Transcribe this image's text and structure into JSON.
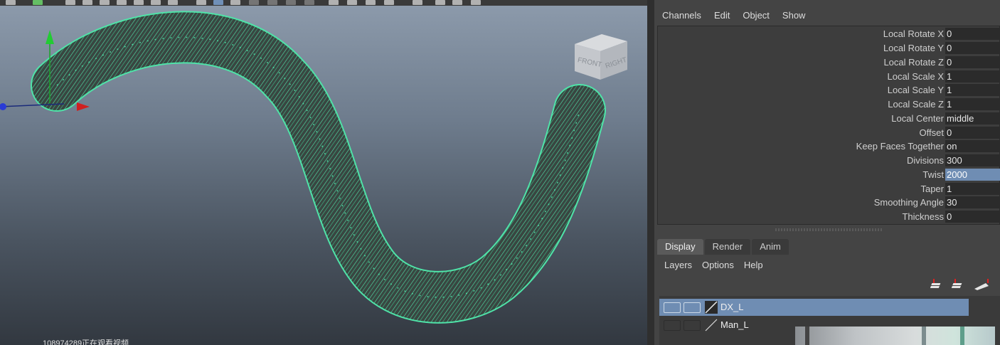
{
  "viewport": {
    "view_cube": {
      "front_label": "FRONT",
      "right_label": "RIGHT"
    },
    "watermark": "108974289正在观看视频",
    "colors": {
      "wireframe": "#4fe3a8",
      "rope_fill": "#394641"
    }
  },
  "channel_box": {
    "menu": [
      "Channels",
      "Edit",
      "Object",
      "Show"
    ],
    "attributes": [
      {
        "label": "Local Rotate X",
        "value": "0"
      },
      {
        "label": "Local Rotate Y",
        "value": "0"
      },
      {
        "label": "Local Rotate Z",
        "value": "0"
      },
      {
        "label": "Local Scale X",
        "value": "1"
      },
      {
        "label": "Local Scale Y",
        "value": "1"
      },
      {
        "label": "Local Scale Z",
        "value": "1"
      },
      {
        "label": "Local Center",
        "value": "middle"
      },
      {
        "label": "Offset",
        "value": "0"
      },
      {
        "label": "Keep Faces Together",
        "value": "on"
      },
      {
        "label": "Divisions",
        "value": "300"
      },
      {
        "label": "Twist",
        "value": "2000",
        "selected": true
      },
      {
        "label": "Taper",
        "value": "1"
      },
      {
        "label": "Smoothing Angle",
        "value": "30"
      },
      {
        "label": "Thickness",
        "value": "0"
      }
    ]
  },
  "layer_editor": {
    "tabs": [
      "Display",
      "Render",
      "Anim"
    ],
    "active_tab": "Display",
    "menu": [
      "Layers",
      "Options",
      "Help"
    ],
    "layers": [
      {
        "name": "DX_L",
        "selected": true
      },
      {
        "name": "Man_L",
        "selected": false
      }
    ]
  }
}
